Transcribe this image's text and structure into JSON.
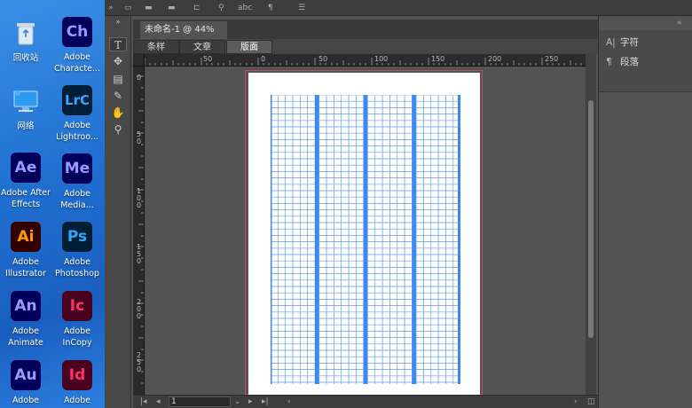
{
  "desktop": {
    "icons": [
      {
        "name": "recycle-bin",
        "label": "回收站",
        "symbol": "♻",
        "bg": "transparent",
        "fg": "#cfe3ff"
      },
      {
        "name": "network",
        "label": "网络",
        "symbol": "🖥",
        "bg": "transparent",
        "fg": "#cfe3ff"
      },
      {
        "name": "after-effects",
        "label": "Adobe After Effects",
        "label1": "Adobe After",
        "label2": "Effects",
        "symbol": "Ae",
        "bg": "#00005b",
        "fg": "#9999ff"
      },
      {
        "name": "illustrator",
        "label1": "Adobe",
        "label2": "Illustrator",
        "symbol": "Ai",
        "bg": "#330000",
        "fg": "#ff9a00"
      },
      {
        "name": "animate",
        "label1": "Adobe",
        "label2": "Animate",
        "symbol": "An",
        "bg": "#00005b",
        "fg": "#9999ff"
      },
      {
        "name": "audition",
        "label1": "Adobe",
        "symbol": "Au",
        "bg": "#00005b",
        "fg": "#9999ff"
      },
      {
        "name": "character-animator",
        "label1": "Adobe",
        "label2": "Characte...",
        "symbol": "Ch",
        "bg": "#00005b",
        "fg": "#9999ff"
      },
      {
        "name": "lightroom-classic",
        "label1": "Adobe",
        "label2": "Lightroo...",
        "symbol": "LrC",
        "bg": "#001e36",
        "fg": "#31a8ff"
      },
      {
        "name": "media-encoder",
        "label1": "Adobe",
        "label2": "Media...",
        "symbol": "Me",
        "bg": "#00005b",
        "fg": "#9999ff"
      },
      {
        "name": "photoshop",
        "label1": "Adobe",
        "label2": "Photoshop",
        "symbol": "Ps",
        "bg": "#001e36",
        "fg": "#31a8ff"
      },
      {
        "name": "incopy",
        "label1": "Adobe",
        "label2": "InCopy",
        "symbol": "Ic",
        "bg": "#49021f",
        "fg": "#ff3366"
      },
      {
        "name": "indesign",
        "label1": "Adobe",
        "symbol": "Id",
        "bg": "#49021f",
        "fg": "#ff3366"
      }
    ]
  },
  "app": {
    "document_tab": "未命名-1 @ 44%",
    "close_symbol": "×",
    "subtabs": [
      "条样",
      "文章",
      "版面"
    ],
    "active_subtab": 2,
    "h_ruler_ticks": [
      "50",
      "0",
      "50",
      "100",
      "150",
      "200",
      "250"
    ],
    "v_ruler_ticks": [
      "0",
      "50",
      "100",
      "150",
      "200",
      "250"
    ],
    "page_number": "1",
    "right_panel": [
      {
        "icon": "character-icon",
        "glyph": "A|",
        "label": "字符"
      },
      {
        "icon": "paragraph-icon",
        "glyph": "¶",
        "label": "段落"
      }
    ],
    "colors": {
      "grid_line": "#6aa2f0",
      "grid_column": "#3d88f0",
      "bleed": "#c94b5d"
    }
  }
}
